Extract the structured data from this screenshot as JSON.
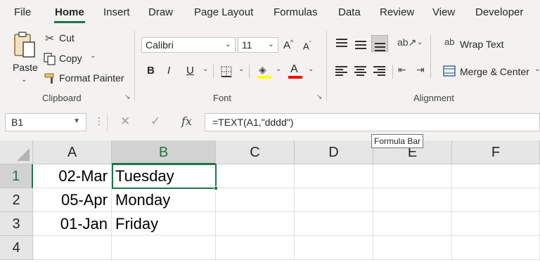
{
  "menu": {
    "tabs": [
      "File",
      "Home",
      "Insert",
      "Draw",
      "Page Layout",
      "Formulas",
      "Data",
      "Review",
      "View",
      "Developer"
    ],
    "active_tab": "Home"
  },
  "ribbon": {
    "clipboard": {
      "paste_label": "Paste",
      "cut_label": "Cut",
      "copy_label": "Copy",
      "format_painter_label": "Format Painter",
      "group_label": "Clipboard"
    },
    "font": {
      "font_name": "Calibri",
      "font_size": "11",
      "bold": "B",
      "italic": "I",
      "underline": "U",
      "group_label": "Font",
      "highlight_color": "#ffff00",
      "font_color": "#ff0000"
    },
    "alignment": {
      "wrap_text_label": "Wrap Text",
      "merge_center_label": "Merge & Center",
      "group_label": "Alignment"
    }
  },
  "formula_bar": {
    "name_box": "B1",
    "fx": "fx",
    "formula": "=TEXT(A1,\"dddd\")",
    "tooltip": "Formula Bar"
  },
  "sheet": {
    "columns": [
      "A",
      "B",
      "C",
      "D",
      "E",
      "F"
    ],
    "rows": [
      "1",
      "2",
      "3",
      "4"
    ],
    "selected_cell": "B1",
    "cells": {
      "A1": "02-Mar",
      "B1": "Tuesday",
      "A2": "05-Apr",
      "B2": "Monday",
      "A3": "01-Jan",
      "B3": "Friday"
    }
  },
  "colors": {
    "accent": "#217346"
  }
}
